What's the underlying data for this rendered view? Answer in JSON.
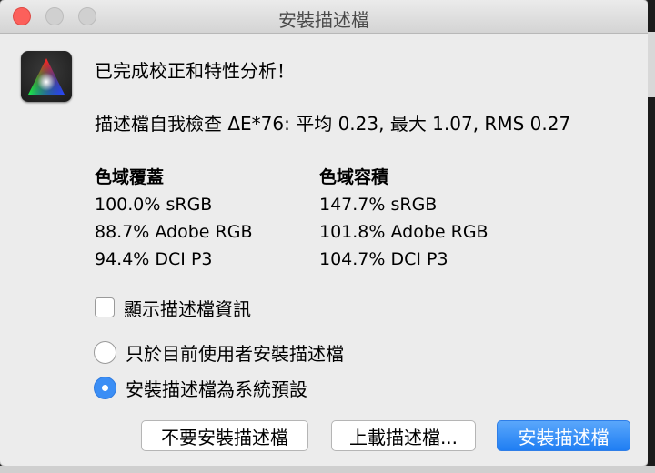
{
  "window": {
    "title": "安裝描述檔"
  },
  "icons": {
    "app": "color-triangle-icon"
  },
  "message": {
    "headline": "已完成校正和特性分析！",
    "self_check": "描述檔自我檢查 ΔE*76: 平均 0.23, 最大 1.07, RMS 0.27"
  },
  "gamut_coverage": {
    "heading": "色域覆蓋",
    "items": [
      "100.0% sRGB",
      "88.7% Adobe RGB",
      "94.4% DCI P3"
    ]
  },
  "gamut_volume": {
    "heading": "色域容積",
    "items": [
      "147.7% sRGB",
      "101.8% Adobe RGB",
      "104.7% DCI P3"
    ]
  },
  "options": {
    "show_info_label": "顯示描述檔資訊",
    "show_info_checked": false,
    "radio_current_user_label": "只於目前使用者安裝描述檔",
    "radio_system_default_label": "安裝描述檔為系統預設",
    "selected_radio": "system_default"
  },
  "buttons": {
    "dont_install": "不要安裝描述檔",
    "upload": "上載描述檔...",
    "install": "安裝描述檔"
  },
  "colors": {
    "accent": "#3b8ef5",
    "close": "#fc605b"
  }
}
